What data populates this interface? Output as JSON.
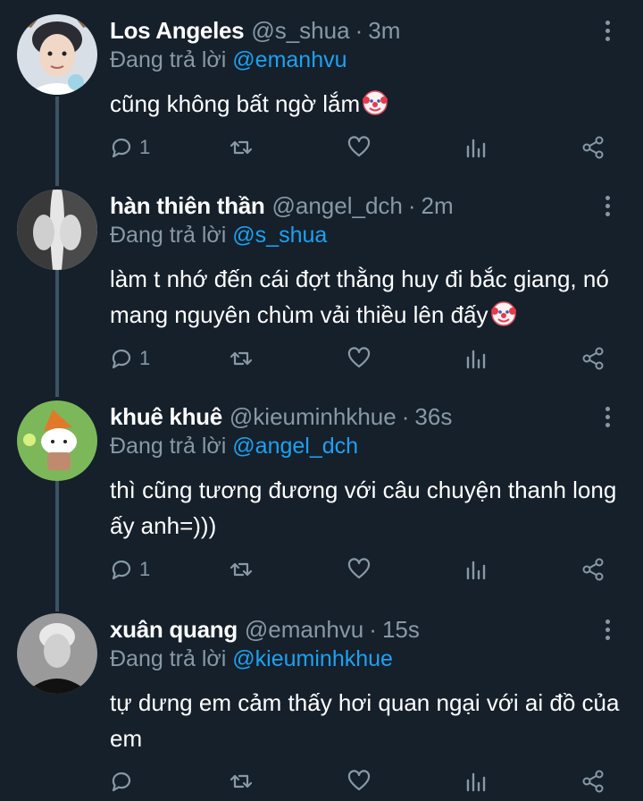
{
  "colors": {
    "background": "#15202b",
    "muted": "#8899a6",
    "link": "#1da1f2",
    "thread_line": "#3d5466"
  },
  "tweets": [
    {
      "name": "Los Angeles",
      "handle": "@s_shua",
      "sep": "·",
      "time": "3m",
      "reply_prefix": "Đang trả lời",
      "reply_to": "@emanhvu",
      "text": "cũng không bất ngờ lắm",
      "emoji": "clown-face",
      "reply_count": "1"
    },
    {
      "name": "hàn thiên thần",
      "handle": "@angel_dch",
      "sep": "·",
      "time": "2m",
      "reply_prefix": "Đang trả lời",
      "reply_to": "@s_shua",
      "text": "làm t nhớ đến cái đợt thằng huy đi bắc giang, nó mang nguyên chùm vải thiều lên đấy",
      "emoji": "clown-face",
      "reply_count": "1"
    },
    {
      "name": "khuê khuê",
      "handle": "@kieuminhkhue",
      "sep": "·",
      "time": "36s",
      "reply_prefix": "Đang trả lời",
      "reply_to": "@angel_dch",
      "text": "thì cũng tương đương với câu chuyện thanh long ấy anh=)))",
      "emoji": "",
      "reply_count": "1"
    },
    {
      "name": "xuân quang",
      "handle": "@emanhvu",
      "sep": "·",
      "time": "15s",
      "reply_prefix": "Đang trả lời",
      "reply_to": "@kieuminhkhue",
      "text": "tự dưng em cảm thấy hơi quan ngại với ai đồ của em",
      "emoji": "",
      "reply_count": ""
    }
  ],
  "icons": {
    "reply": "reply-icon",
    "retweet": "retweet-icon",
    "like": "heart-icon",
    "views": "views-chart-icon",
    "share": "share-icon",
    "more": "more-options-icon"
  }
}
